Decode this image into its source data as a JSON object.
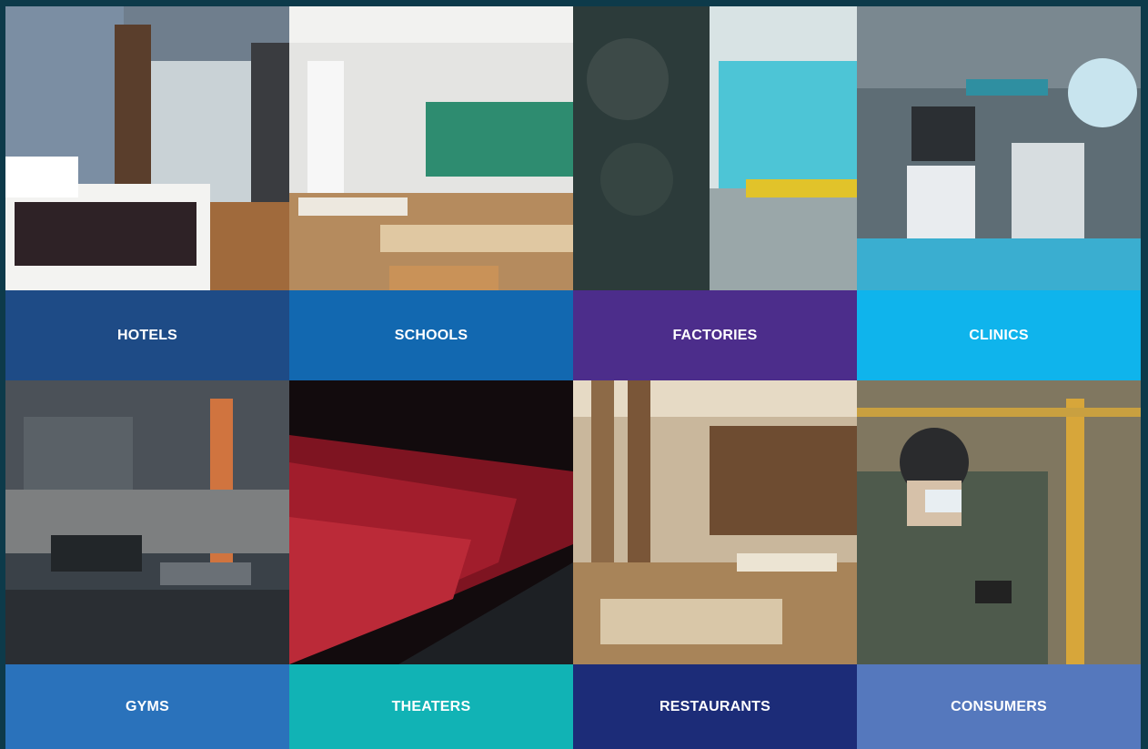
{
  "tiles": [
    {
      "label": "HOTELS",
      "color": "#1e4b86"
    },
    {
      "label": "SCHOOLS",
      "color": "#1268b0"
    },
    {
      "label": "FACTORIES",
      "color": "#4c2d8b"
    },
    {
      "label": "CLINICS",
      "color": "#0fb4ec"
    },
    {
      "label": "GYMS",
      "color": "#2a72bb"
    },
    {
      "label": "THEATERS",
      "color": "#11b3b5"
    },
    {
      "label": "RESTAURANTS",
      "color": "#1c2c78"
    },
    {
      "label": "CONSUMERS",
      "color": "#5578bd"
    }
  ]
}
